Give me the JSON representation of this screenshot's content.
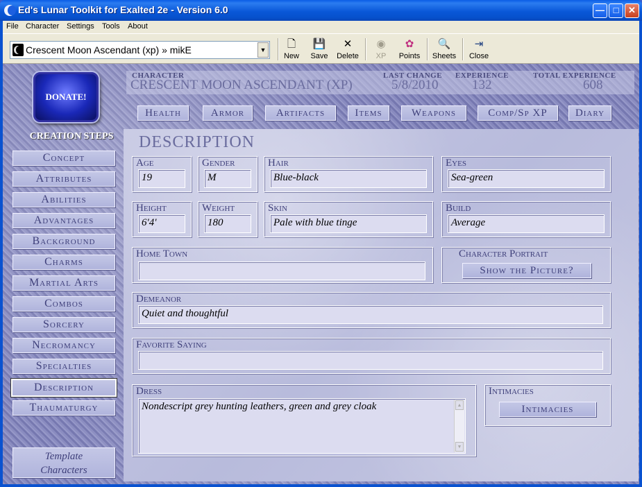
{
  "window": {
    "title": "Ed's Lunar Toolkit for Exalted 2e - Version 6.0",
    "minimize": "—",
    "maximize": "□",
    "close": "✕"
  },
  "menu": [
    "File",
    "Character",
    "Settings",
    "Tools",
    "About"
  ],
  "toolbar": {
    "character_select": "Crescent Moon Ascendant (xp) » mikE",
    "buttons": [
      {
        "label": "New",
        "icon": "new-document-icon",
        "glyph": "🗋"
      },
      {
        "label": "Save",
        "icon": "save-disk-icon",
        "glyph": "💾"
      },
      {
        "label": "Delete",
        "icon": "delete-x-icon",
        "glyph": "✕"
      },
      {
        "label": "XP",
        "icon": "xp-icon",
        "glyph": "◉"
      },
      {
        "label": "Points",
        "icon": "points-palette-icon",
        "glyph": "✿"
      },
      {
        "label": "Sheets",
        "icon": "sheets-search-icon",
        "glyph": "🔍"
      },
      {
        "label": "Close",
        "icon": "exit-door-icon",
        "glyph": "⇥"
      }
    ]
  },
  "donate_label": "DONATE!",
  "sidebar": {
    "title": "CREATION STEPS",
    "steps": [
      "Concept",
      "Attributes",
      "Abilities",
      "Advantages",
      "Background",
      "Charms",
      "Martial Arts",
      "Combos",
      "Sorcery",
      "Necromancy",
      "Specialties",
      "Description",
      "Thaumaturgy"
    ],
    "active": "Description",
    "template_line1": "Template",
    "template_line2": "Characters"
  },
  "header": {
    "character_label": "CHARACTER",
    "character_value": "CRESCENT MOON ASCENDANT (XP)",
    "last_change_label": "LAST CHANGE",
    "last_change_value": "5/8/2010",
    "experience_label": "EXPERIENCE",
    "experience_value": "132",
    "total_experience_label": "TOTAL EXPERIENCE",
    "total_experience_value": "608"
  },
  "tabs": [
    "Health",
    "Armor",
    "Artifacts",
    "Items",
    "Weapons",
    "Comp/Sp XP",
    "Diary"
  ],
  "description": {
    "title": "DESCRIPTION",
    "age": {
      "label": "Age",
      "value": "19"
    },
    "gender": {
      "label": "Gender",
      "value": "M"
    },
    "hair": {
      "label": "Hair",
      "value": "Blue-black"
    },
    "eyes": {
      "label": "Eyes",
      "value": "Sea-green"
    },
    "height": {
      "label": "Height",
      "value": "6'4'"
    },
    "weight": {
      "label": "Weight",
      "value": "180"
    },
    "skin": {
      "label": "Skin",
      "value": "Pale with blue tinge"
    },
    "build": {
      "label": "Build",
      "value": "Average"
    },
    "home_town": {
      "label": "Home Town",
      "value": ""
    },
    "portrait": {
      "label": "Character Portrait",
      "button": "Show the Picture?"
    },
    "demeanor": {
      "label": "Demeanor",
      "value": "Quiet and thoughtful"
    },
    "favorite_saying": {
      "label": "Favorite Saying",
      "value": ""
    },
    "dress": {
      "label": "Dress",
      "value": "Nondescript grey hunting leathers, green and grey cloak"
    },
    "intimacies": {
      "label": "Intimacies",
      "button": "Intimacies"
    }
  }
}
